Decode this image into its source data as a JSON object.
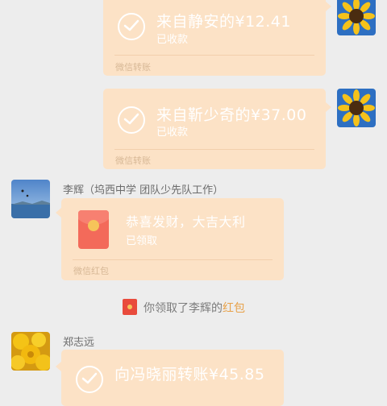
{
  "transfers": [
    {
      "amount": "来自静安的¥12.41",
      "status": "已收款",
      "footer": "微信转账"
    },
    {
      "amount": "来自靳少奇的¥37.00",
      "status": "已收款",
      "footer": "微信转账"
    },
    {
      "amount": "向冯晓丽转账¥45.85",
      "status": "",
      "footer": ""
    }
  ],
  "senders": [
    {
      "name": "李辉（坞西中学 团队少先队工作）"
    },
    {
      "name": "郑志远"
    }
  ],
  "red_packet": {
    "title": "恭喜发财，大吉大利",
    "status": "已领取",
    "footer": "微信红包"
  },
  "notice": {
    "prefix": "你领取了李辉的",
    "highlight": "红包"
  },
  "colors": {
    "bubble": "#fce2c6",
    "background": "#ededed",
    "highlight": "#e8a24a",
    "envelope": "#f36a5a"
  },
  "icons": [
    "check-circle-icon",
    "red-packet-icon",
    "sunflower-avatar",
    "lake-avatar",
    "chrysanthemum-avatar"
  ]
}
